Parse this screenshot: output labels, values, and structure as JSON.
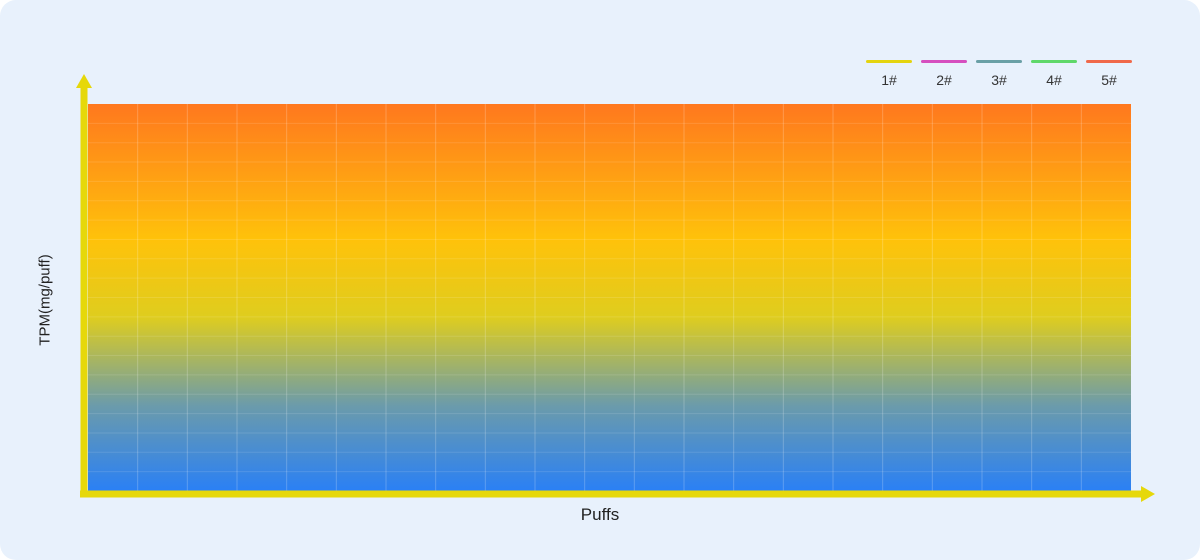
{
  "chart_data": {
    "type": "line",
    "xlabel": "Puffs",
    "ylabel": "TPM(mg/puff)",
    "grid": true,
    "legend_position": "top-right",
    "series": [
      {
        "name": "1#",
        "color": "#e4d40f",
        "values": []
      },
      {
        "name": "2#",
        "color": "#d64fbf",
        "values": []
      },
      {
        "name": "3#",
        "color": "#6aa0a6",
        "values": []
      },
      {
        "name": "4#",
        "color": "#5fd86a",
        "values": []
      },
      {
        "name": "5#",
        "color": "#f0694a",
        "values": []
      }
    ],
    "background_gradient": [
      "#ff781e",
      "#ffc20a",
      "#dfcd1e",
      "#6b9bab",
      "#2a80f5"
    ],
    "axis_color": "#e6d80a"
  }
}
